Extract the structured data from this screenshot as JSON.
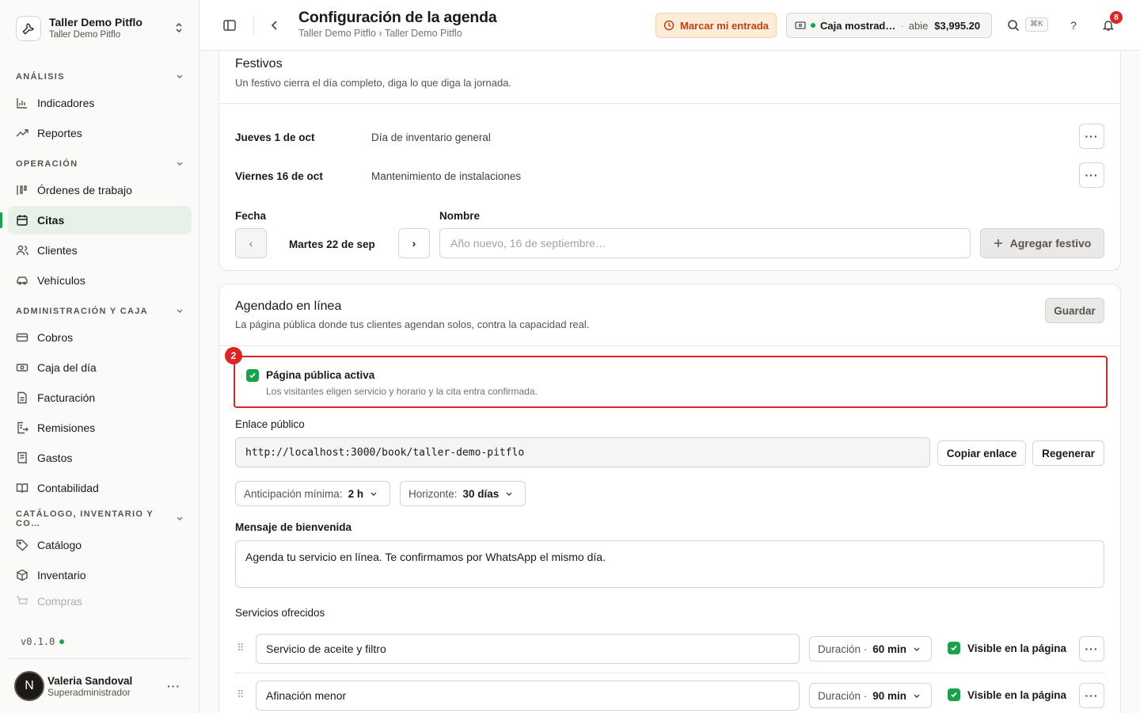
{
  "org": {
    "name": "Taller Demo Pitflo",
    "sub": "Taller Demo Pitflo"
  },
  "nav": {
    "analysis": {
      "title": "ANÁLISIS",
      "items": [
        "Indicadores",
        "Reportes"
      ]
    },
    "operation": {
      "title": "OPERACIÓN",
      "items": [
        "Órdenes de trabajo",
        "Citas",
        "Clientes",
        "Vehículos"
      ]
    },
    "admin": {
      "title": "ADMINISTRACIÓN Y CAJA",
      "items": [
        "Cobros",
        "Caja del día",
        "Facturación",
        "Remisiones",
        "Gastos",
        "Contabilidad"
      ]
    },
    "catalog": {
      "title": "CATÁLOGO, INVENTARIO Y CO…",
      "items": [
        "Catálogo",
        "Inventario",
        "Compras"
      ]
    },
    "active": "Citas"
  },
  "version": "v0.1.0",
  "user": {
    "initial": "N",
    "name": "Valeria Sandoval",
    "role": "Superadministrador"
  },
  "topbar": {
    "title": "Configuración de la agenda",
    "breadcrumb": "Taller Demo Pitflo › Taller Demo Pitflo",
    "clock_in": "Marcar mi entrada",
    "cash": {
      "name": "Caja mostrad…",
      "sep": "·",
      "status": "abie",
      "amount": "$3,995.20"
    },
    "shortcut": "⌘K",
    "help": "?",
    "notifications": "8"
  },
  "holidays": {
    "title": "Festivos",
    "subtitle": "Un festivo cierra el día completo, diga lo que diga la jornada.",
    "items": [
      {
        "date": "Jueves 1 de oct",
        "name": "Día de inventario general"
      },
      {
        "date": "Viernes 16 de oct",
        "name": "Mantenimiento de instalaciones"
      }
    ],
    "date_label": "Fecha",
    "name_label": "Nombre",
    "date_value": "Martes 22 de sep",
    "prev": "‹",
    "next": "›",
    "name_placeholder": "Año nuevo, 16 de septiembre…",
    "add_button": "Agregar festivo"
  },
  "online": {
    "title": "Agendado en línea",
    "subtitle": "La página pública donde tus clientes agendan solos, contra la capacidad real.",
    "save": "Guardar",
    "step_badge": "2",
    "active_label": "Página pública activa",
    "active_desc": "Los visitantes eligen servicio y horario y la cita entra confirmada.",
    "active_checked": true,
    "link_label": "Enlace público",
    "link_value": "http://localhost:3000/book/taller-demo-pitflo",
    "copy": "Copiar enlace",
    "regenerate": "Regenerar",
    "min_advance": {
      "key": "Anticipación mínima:",
      "value": "2 h"
    },
    "horizon": {
      "key": "Horizonte:",
      "value": "30 días"
    },
    "welcome_label": "Mensaje de bienvenida",
    "welcome_value": "Agenda tu servicio en línea. Te confirmamos por WhatsApp el mismo día.",
    "services_label": "Servicios ofrecidos",
    "services": [
      {
        "name": "Servicio de aceite y filtro",
        "duration_key": "Duración ·",
        "duration": "60 min",
        "visible_label": "Visible en la página"
      },
      {
        "name": "Afinación menor",
        "duration_key": "Duración ·",
        "duration": "90 min",
        "visible_label": "Visible en la página"
      }
    ]
  }
}
